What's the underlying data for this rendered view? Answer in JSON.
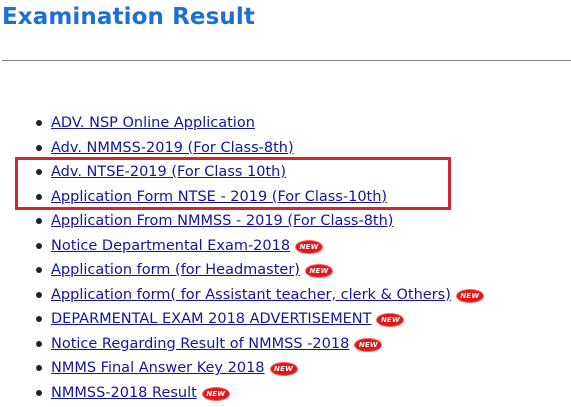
{
  "page": {
    "title": "Examination Result"
  },
  "badge_text": "NEW",
  "highlight_color": "#d3262e",
  "links": [
    {
      "label": "ADV. NSP Online Application",
      "new": false
    },
    {
      "label": "Adv. NMMSS-2019 (For Class-8th)",
      "new": false
    },
    {
      "label": "Adv. NTSE-2019 (For Class 10th)",
      "new": false
    },
    {
      "label": "Application Form NTSE - 2019 (For Class-10th)",
      "new": false
    },
    {
      "label": "Application From NMMSS - 2019 (For Class-8th)",
      "new": false
    },
    {
      "label": "Notice Departmental Exam-2018",
      "new": true
    },
    {
      "label": "Application form (for Headmaster)",
      "new": true
    },
    {
      "label": "Application form( for Assistant teacher, clerk & Others)",
      "new": true
    },
    {
      "label": "DEPARMENTAL EXAM 2018 ADVERTISEMENT",
      "new": true
    },
    {
      "label": "Notice Regarding Result of NMMSS -2018",
      "new": true
    },
    {
      "label": "NMMS Final Answer Key 2018",
      "new": true
    },
    {
      "label": "NMMSS-2018 Result",
      "new": true
    }
  ]
}
